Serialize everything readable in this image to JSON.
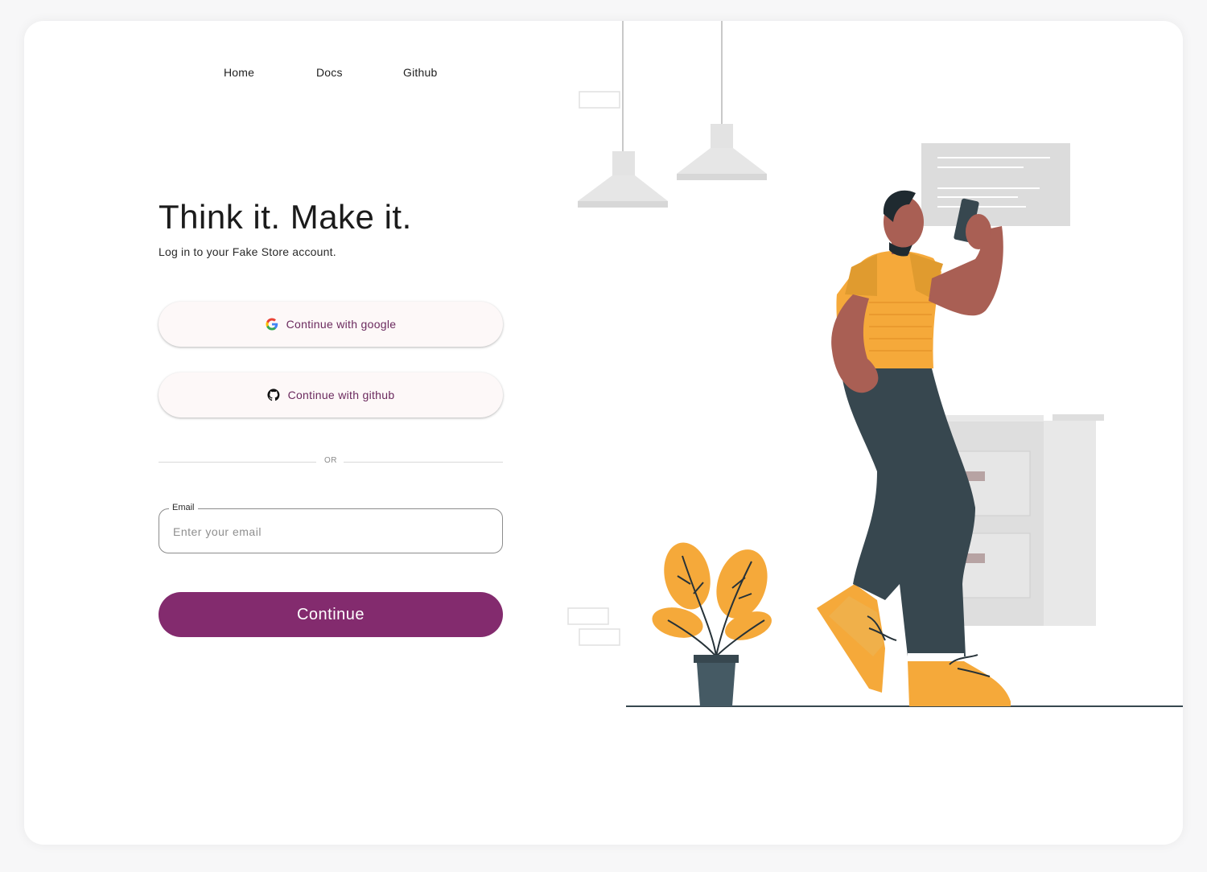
{
  "nav": {
    "items": [
      {
        "label": "Home"
      },
      {
        "label": "Docs"
      },
      {
        "label": "Github"
      }
    ]
  },
  "hero": {
    "title": "Think it. Make it.",
    "subtitle": "Log in to your Fake Store account."
  },
  "auth": {
    "google_label": "Continue with google",
    "github_label": "Continue with github",
    "divider_text": "OR",
    "email": {
      "label": "Email",
      "placeholder": "Enter your email",
      "value": ""
    },
    "continue_label": "Continue"
  },
  "theme": {
    "primary": "#832b6e",
    "oauth_text": "#6b2a5e",
    "oauth_bg": "#fdf8f8"
  },
  "illustration": {
    "subject": "person-with-phone-illustration",
    "accent": "#f5a93a",
    "pants": "#37474f",
    "skin": "#a95f54"
  }
}
